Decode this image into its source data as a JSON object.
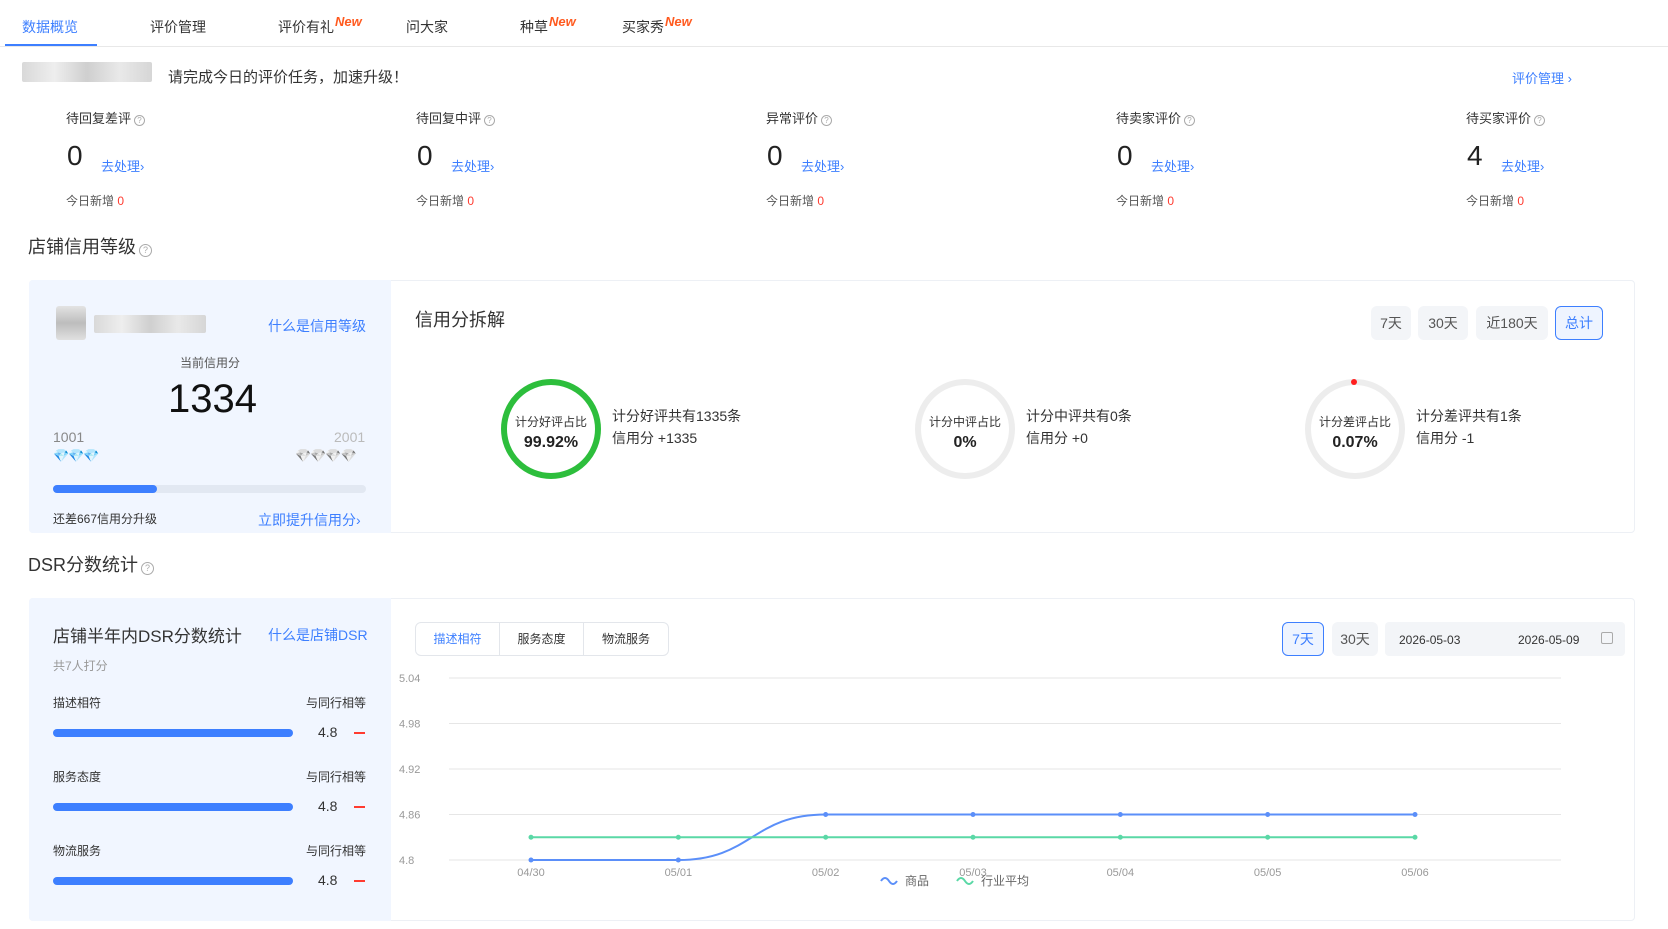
{
  "tabs": [
    {
      "label": "数据概览",
      "badge": ""
    },
    {
      "label": "评价管理",
      "badge": ""
    },
    {
      "label": "评价有礼",
      "badge": "New"
    },
    {
      "label": "问大家",
      "badge": ""
    },
    {
      "label": "种草",
      "badge": "New"
    },
    {
      "label": "买家秀",
      "badge": "New"
    }
  ],
  "notice": {
    "text": "请完成今日的评价任务，加速升级！",
    "eval_link": "评价管理 ›"
  },
  "stats": [
    {
      "label": "待回复差评",
      "value": "0",
      "action": "去处理›",
      "today_label": "今日新增",
      "today_value": "0"
    },
    {
      "label": "待回复中评",
      "value": "0",
      "action": "去处理›",
      "today_label": "今日新增",
      "today_value": "0"
    },
    {
      "label": "异常评价",
      "value": "0",
      "action": "去处理›",
      "today_label": "今日新增",
      "today_value": "0"
    },
    {
      "label": "待卖家评价",
      "value": "0",
      "action": "去处理›",
      "today_label": "今日新增",
      "today_value": "0"
    },
    {
      "label": "待买家评价",
      "value": "4",
      "action": "去处理›",
      "today_label": "今日新增",
      "today_value": "0"
    }
  ],
  "credit": {
    "section_title": "店铺信用等级",
    "what_link": "什么是信用等级",
    "current_label": "当前信用分",
    "score": "1334",
    "min": "1001",
    "max": "2001",
    "progress": 0.333,
    "remaining_text": "还差667信用分升级",
    "upgrade_link": "立即提升信用分›",
    "breakdown_title": "信用分拆解",
    "ranges": [
      "7天",
      "30天",
      "近180天",
      "总计"
    ],
    "active_range": "总计",
    "rings": [
      {
        "title": "计分好评占比",
        "value": "99.92%",
        "desc1": "计分好评共有1335条",
        "desc2": "信用分 +1335",
        "fraction": 0.9992,
        "color": "#2dbe3c"
      },
      {
        "title": "计分中评占比",
        "value": "0%",
        "desc1": "计分中评共有0条",
        "desc2": "信用分 +0",
        "fraction": 0,
        "color": "#2dbe3c"
      },
      {
        "title": "计分差评占比",
        "value": "0.07%",
        "desc1": "计分差评共有1条",
        "desc2": "信用分 -1",
        "fraction": 0.0007,
        "color": "#ff1f1f"
      }
    ]
  },
  "dsr": {
    "section_title": "DSR分数统计",
    "card_title": "店铺半年内DSR分数统计",
    "what_link": "什么是店铺DSR",
    "raters": "共7人打分",
    "items": [
      {
        "label": "描述相符",
        "compare": "与同行相等",
        "score": "4.8"
      },
      {
        "label": "服务态度",
        "compare": "与同行相等",
        "score": "4.8"
      },
      {
        "label": "物流服务",
        "compare": "与同行相等",
        "score": "4.8"
      }
    ],
    "segments": [
      "描述相符",
      "服务态度",
      "物流服务"
    ],
    "active_segment": "描述相符",
    "ranges": [
      "7天",
      "30天"
    ],
    "active_range": "7天",
    "date_start": "2026-05-03",
    "date_end": "2026-05-09"
  },
  "chart_data": {
    "type": "line",
    "x": [
      "04/30",
      "05/01",
      "05/02",
      "05/03",
      "05/04",
      "05/05",
      "05/06"
    ],
    "y_ticks": [
      "5.04",
      "4.98",
      "4.92",
      "4.86",
      "4.8"
    ],
    "ylim": [
      4.8,
      5.04
    ],
    "series": [
      {
        "name": "商品",
        "values": [
          4.8,
          4.8,
          4.86,
          4.86,
          4.86,
          4.86,
          4.86
        ],
        "color": "#5b8ff9"
      },
      {
        "name": "行业平均",
        "values": [
          4.83,
          4.83,
          4.83,
          4.83,
          4.83,
          4.83,
          4.83
        ],
        "color": "#5ad8a6"
      }
    ],
    "legend": "bottom",
    "grid": true
  }
}
